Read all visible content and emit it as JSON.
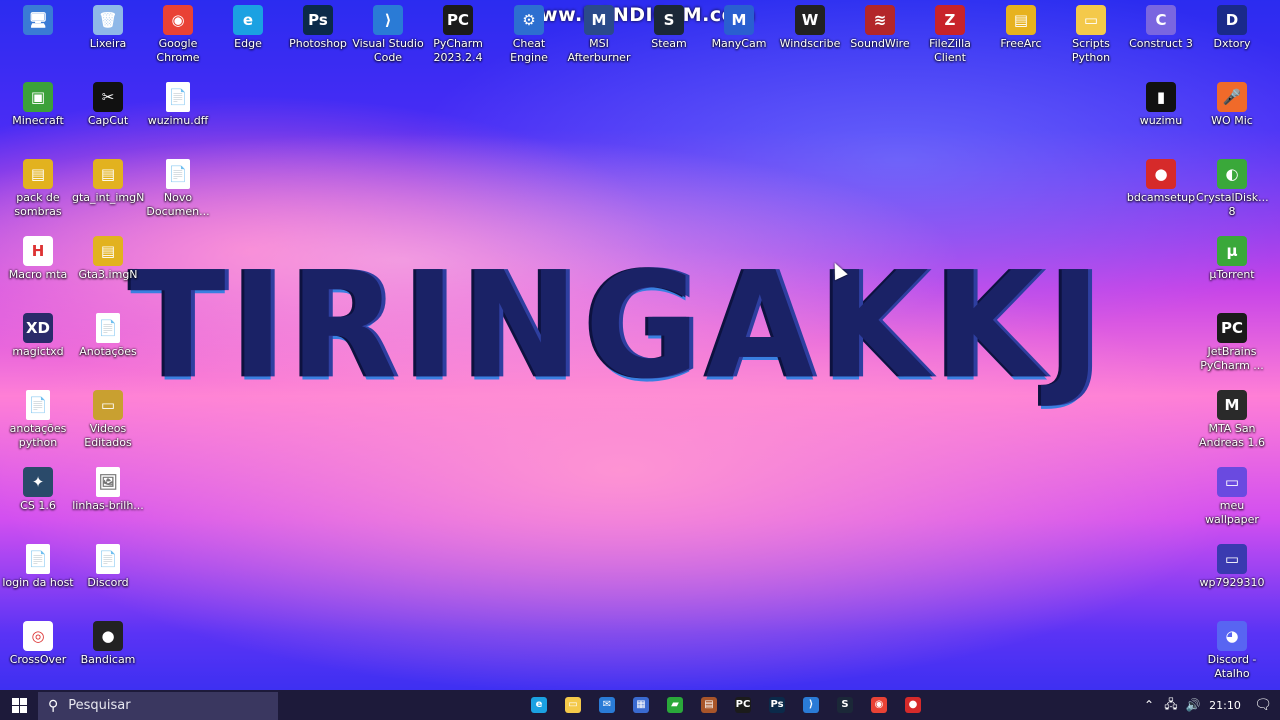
{
  "watermark": "www.BANDICAM.com",
  "hero_text": "TIRINGAKKJ",
  "desktop_icons": [
    {
      "label": "",
      "icon": "computer-icon",
      "color": "#3a7bd5",
      "glyph": "🖥"
    },
    {
      "label": "Lixeira",
      "icon": "recycle-bin-icon",
      "color": "#8fb8e8",
      "glyph": "🗑"
    },
    {
      "label": "Google Chrome",
      "icon": "chrome-icon",
      "color": "#e94235",
      "glyph": "◉"
    },
    {
      "label": "Edge",
      "icon": "edge-icon",
      "color": "#1ba1e2",
      "glyph": "e"
    },
    {
      "label": "Photoshop",
      "icon": "photoshop-icon",
      "color": "#0b2a4a",
      "glyph": "Ps"
    },
    {
      "label": "Visual Studio Code",
      "icon": "vscode-icon",
      "color": "#2a7bd6",
      "glyph": "⟩"
    },
    {
      "label": "PyCharm 2023.2.4",
      "icon": "pycharm-icon",
      "color": "#1b1b1b",
      "glyph": "PC"
    },
    {
      "label": "Cheat Engine",
      "icon": "cheat-engine-icon",
      "color": "#2d6fd0",
      "glyph": "⚙"
    },
    {
      "label": "MSI Afterburner",
      "icon": "msi-afterburner-icon",
      "color": "#2b4a8a",
      "glyph": "M"
    },
    {
      "label": "Steam",
      "icon": "steam-icon",
      "color": "#1b2838",
      "glyph": "S"
    },
    {
      "label": "ManyCam",
      "icon": "manycam-icon",
      "color": "#2a5fd0",
      "glyph": "M"
    },
    {
      "label": "Windscribe",
      "icon": "windscribe-icon",
      "color": "#222222",
      "glyph": "W"
    },
    {
      "label": "SoundWire",
      "icon": "soundwire-icon",
      "color": "#b3262a",
      "glyph": "≋"
    },
    {
      "label": "FileZilla Client",
      "icon": "filezilla-icon",
      "color": "#c8232a",
      "glyph": "Z"
    },
    {
      "label": "FreeArc",
      "icon": "freearc-icon",
      "color": "#e7b21f",
      "glyph": "▤"
    },
    {
      "label": "Scripts Python",
      "icon": "folder-icon",
      "color": "#f4c94a",
      "glyph": "▭"
    },
    {
      "label": "Construct 3",
      "icon": "construct-icon",
      "color": "#7a66e0",
      "glyph": "C"
    },
    {
      "label": "Dxtory",
      "icon": "dxtory-icon",
      "color": "#1a2a8a",
      "glyph": "D"
    },
    {
      "label": "Minecraft",
      "icon": "minecraft-icon",
      "color": "#3ca13a",
      "glyph": "▣"
    },
    {
      "label": "CapCut",
      "icon": "capcut-icon",
      "color": "#111111",
      "glyph": "✂"
    },
    {
      "label": "wuzimu.dff",
      "icon": "file-icon",
      "color": "#ffffff",
      "glyph": "📄"
    },
    {
      "label": "wuzimu",
      "icon": "wuzimu-icon",
      "color": "#111111",
      "glyph": "▮"
    },
    {
      "label": "WO Mic",
      "icon": "wo-mic-icon",
      "color": "#f06a2a",
      "glyph": "🎤"
    },
    {
      "label": "pack de sombras",
      "icon": "archive-icon",
      "color": "#e2b21f",
      "glyph": "▤"
    },
    {
      "label": "gta_int_imgN",
      "icon": "archive-icon",
      "color": "#e2b21f",
      "glyph": "▤"
    },
    {
      "label": "Novo Documen...",
      "icon": "file-icon",
      "color": "#ffffff",
      "glyph": "📄"
    },
    {
      "label": "bdcamsetup",
      "icon": "bandicam-setup-icon",
      "color": "#d62a2a",
      "glyph": "●"
    },
    {
      "label": "CrystalDisk... 8",
      "icon": "crystaldisk-icon",
      "color": "#3aa83a",
      "glyph": "◐"
    },
    {
      "label": "Macro mta",
      "icon": "macro-icon",
      "color": "#ffffff",
      "glyph": "H"
    },
    {
      "label": "Gta3.imgN",
      "icon": "archive-icon",
      "color": "#e2b21f",
      "glyph": "▤"
    },
    {
      "label": "µTorrent",
      "icon": "utorrent-icon",
      "color": "#3aa83a",
      "glyph": "µ"
    },
    {
      "label": "magictxd",
      "icon": "magictxd-icon",
      "color": "#2a2a6a",
      "glyph": "XD"
    },
    {
      "label": "Anotações",
      "icon": "file-icon",
      "color": "#ffffff",
      "glyph": "📄"
    },
    {
      "label": "JetBrains PyCharm ...",
      "icon": "pycharm-icon",
      "color": "#1b1b1b",
      "glyph": "PC"
    },
    {
      "label": "anotações python",
      "icon": "file-icon",
      "color": "#ffffff",
      "glyph": "📄"
    },
    {
      "label": "Videos Editados",
      "icon": "folder-icon",
      "color": "#c9a030",
      "glyph": "▭"
    },
    {
      "label": "MTA San Andreas 1.6",
      "icon": "mta-icon",
      "color": "#2a2a2a",
      "glyph": "M"
    },
    {
      "label": "CS 1.6",
      "icon": "cs-icon",
      "color": "#2a4a6a",
      "glyph": "✦"
    },
    {
      "label": "linhas-brilh...",
      "icon": "image-file-icon",
      "color": "#ffffff",
      "glyph": "🖼"
    },
    {
      "label": "meu wallpaper",
      "icon": "image-icon",
      "color": "#6a4ae0",
      "glyph": "▭"
    },
    {
      "label": "login da host",
      "icon": "file-icon",
      "color": "#ffffff",
      "glyph": "📄"
    },
    {
      "label": "Discord",
      "icon": "file-icon",
      "color": "#ffffff",
      "glyph": "📄"
    },
    {
      "label": "wp7929310",
      "icon": "image-icon",
      "color": "#3a3ab0",
      "glyph": "▭"
    },
    {
      "label": "CrossOver",
      "icon": "crossover-icon",
      "color": "#ffffff",
      "glyph": "◎"
    },
    {
      "label": "Bandicam",
      "icon": "bandicam-icon",
      "color": "#222222",
      "glyph": "●"
    },
    {
      "label": "Discord - Atalho",
      "icon": "discord-icon",
      "color": "#5865f2",
      "glyph": "◕"
    }
  ],
  "taskbar": {
    "search_placeholder": "Pesquisar",
    "apps": [
      {
        "icon": "edge-icon",
        "color": "#1ba1e2",
        "glyph": "e"
      },
      {
        "icon": "file-explorer-icon",
        "color": "#f4c94a",
        "glyph": "▭"
      },
      {
        "icon": "mail-icon",
        "color": "#2a7bd6",
        "glyph": "✉"
      },
      {
        "icon": "store-icon",
        "color": "#3a6ad0",
        "glyph": "▦"
      },
      {
        "icon": "game-icon",
        "color": "#2aa83a",
        "glyph": "▰"
      },
      {
        "icon": "app-icon",
        "color": "#a8552a",
        "glyph": "▤"
      },
      {
        "icon": "pycharm-icon",
        "color": "#1b1b1b",
        "glyph": "PC"
      },
      {
        "icon": "photoshop-icon",
        "color": "#0b2a4a",
        "glyph": "Ps"
      },
      {
        "icon": "vscode-icon",
        "color": "#2a7bd6",
        "glyph": "⟩"
      },
      {
        "icon": "steam-icon",
        "color": "#1b2838",
        "glyph": "S"
      },
      {
        "icon": "chrome-icon",
        "color": "#e94235",
        "glyph": "◉"
      },
      {
        "icon": "bandicam-icon",
        "color": "#d62a2a",
        "glyph": "●"
      }
    ],
    "clock": "21:10"
  }
}
